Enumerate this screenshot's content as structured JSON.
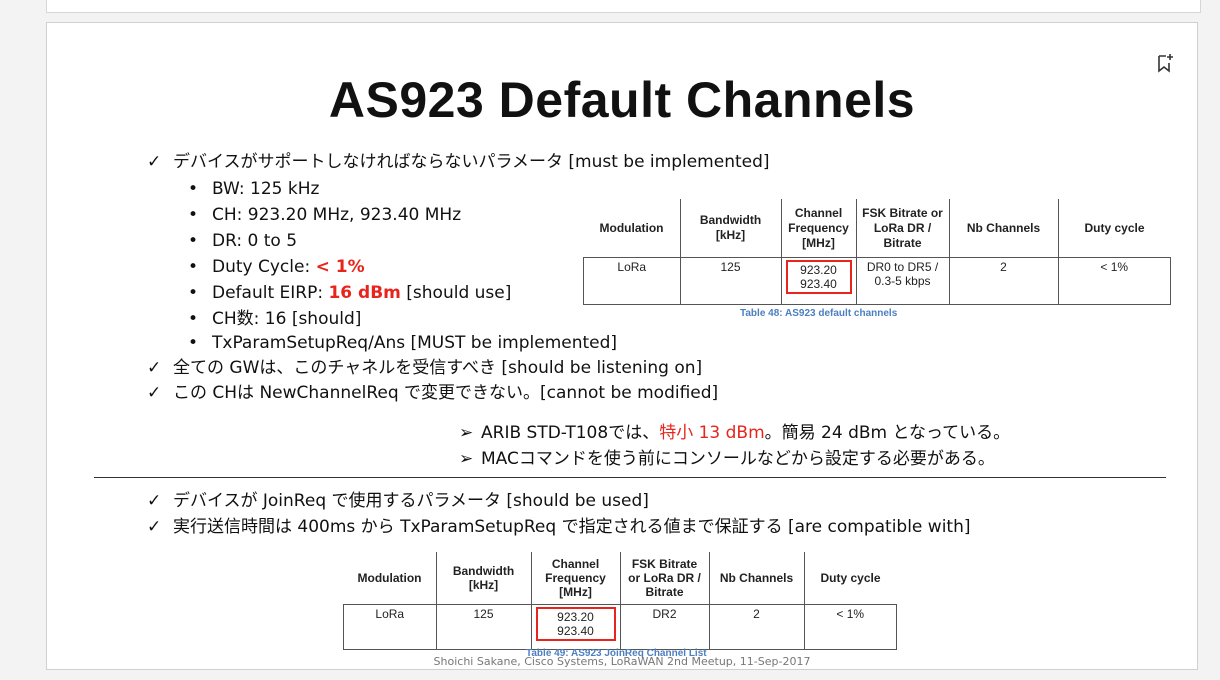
{
  "slide": {
    "title": "AS923 Default Channels",
    "checks1": [
      "デバイスがサポートしなければならないパラメータ [must be implemented]"
    ],
    "bullets": [
      {
        "pre": "BW: 125 kHz",
        "hl": "",
        "post": ""
      },
      {
        "pre": "CH: 923.20 MHz, 923.40 MHz",
        "hl": "",
        "post": ""
      },
      {
        "pre": "DR: 0 to 5",
        "hl": "",
        "post": ""
      },
      {
        "pre": "Duty Cycle: ",
        "hl": "< 1%",
        "post": ""
      },
      {
        "pre": "Default EIRP: ",
        "hl": "16 dBm",
        "post": " [should use]"
      },
      {
        "pre": "CH数: 16 [should]",
        "hl": "",
        "post": ""
      },
      {
        "pre": "TxParamSetupReq/Ans [MUST be implemented]",
        "hl": "",
        "post": ""
      }
    ],
    "checks2": [
      "全ての GWは、このチャネルを受信すべき [should be listening on]",
      "この CHは NewChannelReq で変更できない。[cannot be modified]"
    ],
    "notes": [
      {
        "pre": "ARIB STD-T108では、",
        "hl": "特小 13 dBm",
        "post": "。簡易 24 dBm となっている。"
      },
      {
        "pre": "MACコマンドを使う前にコンソールなどから設定する必要がある。",
        "hl": "",
        "post": ""
      }
    ],
    "checks3": [
      "デバイスが JoinReq で使用するパラメータ [should be used]",
      "実行送信時間は 400ms から TxParamSetupReq で指定される値まで保証する [are compatible with]"
    ],
    "table_headers": [
      "Modulation",
      "Bandwidth [kHz]",
      "Channel Frequency [MHz]",
      "FSK Bitrate or LoRa DR / Bitrate",
      "Nb Channels",
      "Duty cycle"
    ],
    "table1": {
      "row": [
        "LoRa",
        "125",
        "923.20 923.40",
        "DR0 to DR5 / 0.3-5 kbps",
        "2",
        "< 1%"
      ],
      "caption": "Table 48: AS923 default channels"
    },
    "table2": {
      "row": [
        "LoRa",
        "125",
        "923.20 923.40",
        "DR2",
        "2",
        "< 1%"
      ],
      "caption": "Table 49: AS923 JoinReq Channel List"
    },
    "footer": "Shoichi Sakane, Cisco Systems, LoRaWAN 2nd Meetup, 11-Sep-2017"
  },
  "icons": {
    "bookmark": "bookmark-add-icon",
    "check": "checkmark-icon",
    "bullet": "bullet-dot",
    "arrow": "arrowhead-bullet-icon"
  },
  "colors": {
    "highlight": "#e8251d",
    "caption": "#4b7fc0"
  }
}
